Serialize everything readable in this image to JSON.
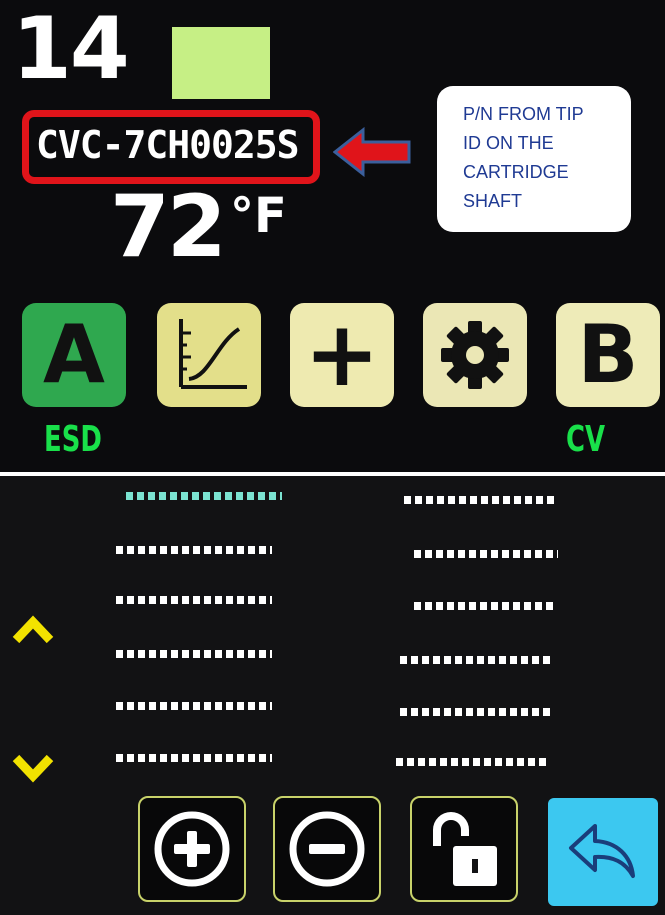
{
  "top_screen": {
    "slot_number": "14",
    "part_number": "CVC-7CH0025S",
    "temperature_value": "72",
    "temperature_unit": "°F",
    "status_color": "#c6ef85",
    "callout_text": "P/N FROM TIP\nID ON THE\nCARTRIDGE\nSHAFT",
    "buttons": [
      {
        "label": "A",
        "icon": "letter-a",
        "color": "#2fa84f"
      },
      {
        "label": "",
        "icon": "curve-graph-icon",
        "color": "#e3df8a"
      },
      {
        "label": "+",
        "icon": "plus-icon",
        "color": "#eeeab0"
      },
      {
        "label": "",
        "icon": "gear-icon",
        "color": "#ebe7b5"
      },
      {
        "label": "B",
        "icon": "letter-b",
        "color": "#eeebb8"
      }
    ],
    "button_a_caption": "ESD",
    "button_b_caption": "CV"
  },
  "bottom_screen": {
    "left_column": [
      "-------------",
      "-------------",
      "-------------",
      "-------------",
      "-------------",
      "-------------"
    ],
    "right_column": [
      "-------------",
      "-------------",
      "-------------",
      "-------------",
      "-------------",
      "-------------"
    ],
    "active_entry_color": "#7be3d1",
    "chevron_color": "#f2e200",
    "controls": [
      {
        "icon": "plus-circle-icon"
      },
      {
        "icon": "minus-circle-icon"
      },
      {
        "icon": "unlock-icon"
      },
      {
        "icon": "back-arrow-icon",
        "color": "#3cc8f0"
      }
    ]
  }
}
